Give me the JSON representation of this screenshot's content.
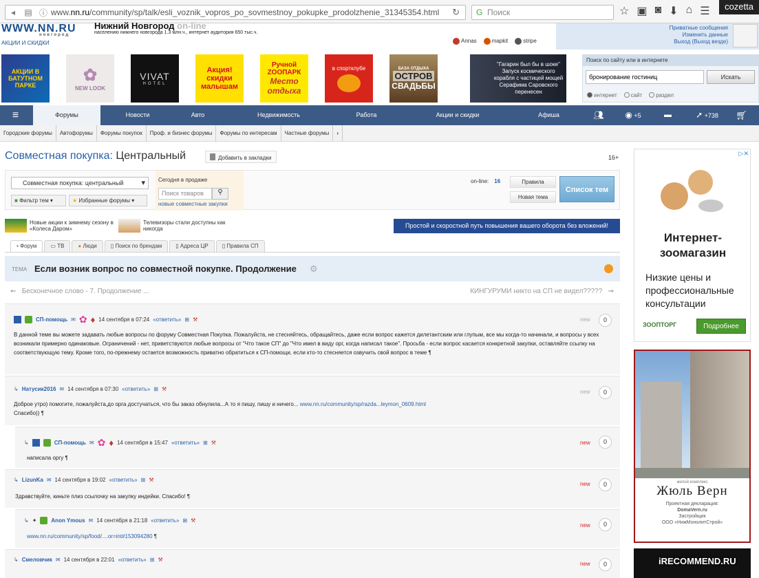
{
  "browser": {
    "url_prefix": "www.",
    "url_domain": "nn.ru",
    "url_path": "/community/sp/talk/esli_voznik_vopros_po_sovmestnoy_pokupke_prodolzhenie_31345354.html",
    "search_placeholder": "Поиск",
    "watermark_user": "cozetta"
  },
  "site": {
    "logo": "WWW.NN.RU",
    "logo_sub": "новгород",
    "city": "Нижний Новгород",
    "city_suffix": "on-line",
    "desc": "населению нижнего новгорода 1.3 млн.ч., интернет аудитория 650 тыс.ч.",
    "promo_link": "АКЦИИ И СКИДКИ",
    "partners": [
      "Annas",
      "mapkit",
      "stripe"
    ],
    "user_links": [
      "Приватные сообщения",
      "Изменить данные",
      "Выход (Выход везде)"
    ]
  },
  "banners": {
    "b1": "АКЦИИ В БАТУТНОМ ПАРКЕ",
    "b2": "NEW LOOK",
    "b3": "VIVAT",
    "b3_sub": "HOTEL",
    "b4": "Акция! скидки малышам",
    "b5_top": "Ручной ZOOПАРК",
    "b5_bottom": "Место отдыха",
    "b6": "в спортклубе",
    "b7_top": "БАЗА ОТДЫХА",
    "b7_mid": "ОСТРОВ",
    "b7_bottom": "СВАДЬБЫ",
    "b8": "\"Гагарин был бы в шоке\" Запуск космического корабля с частицей мощей Серафима Саровского перенесен"
  },
  "search": {
    "header": "Поиск по сайту или в интернете",
    "value": "бронирование гостиниц",
    "button": "Искать",
    "r1": "интернет",
    "r2": "сайт",
    "r3": "раздел"
  },
  "nav": {
    "forums": "Форумы",
    "news": "Новости",
    "auto": "Авто",
    "realty": "Недвижимость",
    "jobs": "Работа",
    "sales": "Акции и скидки",
    "afisha": "Афиша",
    "views": "+5",
    "rating": "+738"
  },
  "subnav": [
    "Городские форумы",
    "Автофорумы",
    "Форумы покупок",
    "Проф. и бизнес форумы",
    "Форумы по интересам",
    "Частные форумы"
  ],
  "page": {
    "title_prefix": "Совместная покупка:",
    "title_section": "Центральный",
    "bookmark": "Добавить в закладки",
    "age": "16+",
    "select": "Совместная покупка: центральный",
    "filter": "Фильтр тем",
    "favorites": "Избранные форумы",
    "sale_title": "Сегодня в продаже",
    "sale_placeholder": "Поиск товаров",
    "sale_link": "новые совместные закупки",
    "online_label": "on-line:",
    "online_count": "16",
    "rules": "Правила",
    "new_topic": "Новая тема",
    "list": "Список тем",
    "news1": "Новые акции к зимнему сезону в «Колеса Даром»",
    "news2": "Телевизоры стали доступны как никогда",
    "strip": "Простой и скоростной путь повышения вашего оборота без вложений!"
  },
  "tabs": [
    "Форум",
    "ТВ",
    "Люди",
    "Поиск по брендам",
    "Адреса ЦР",
    "Правила СП"
  ],
  "topic": {
    "label": "ТЕМА",
    "title": "Если возник вопрос по совместной покупке. Продолжение",
    "prev": "Бесконечное слово - 7. Продолжение ...",
    "next": "КИНГУРУМИ никто на СП не видел?????"
  },
  "posts": [
    {
      "user": "СП-помощь",
      "date": "14 сентября в 07:24",
      "reply": "«ответить»",
      "text": "В данной теме вы можете задавать любые вопросы по форуму Совместная Покупка. Пожалуйста, не стесняйтесь, обращайтесь, даже если вопрос кажется дилетантским или глупым, все мы когда-то начинали, и вопросы у всех возникали примерно одинаковые. Ограничений - нет, приветствуются любые вопросы от \"Что такое СП\" до \"Что имел в виду орг, когда написал такое\". Просьба - если вопрос касается конкретной закупки, оставляйте ссылку на соответствующую тему. Кроме того, по-прежнему остается возможность приватно обратиться к СП-помощи, если кто-то стесняется озвучить свой вопрос в теме ¶",
      "status": "new",
      "count": "0"
    },
    {
      "user": "Натусик2016",
      "date": "14 сентября в 07:30",
      "reply": "«ответить»",
      "text": "Доброе утро) помогите, пожалуйста,до орга достучаться, что бы заказ обнулила...А то я пишу, пишу и ничего...",
      "link": "www.nn.ru/community/sp/razda...leymon_0609.html",
      "text2": "Спасибо)) ¶",
      "status": "new",
      "count": "0"
    },
    {
      "user": "СП-помощь",
      "date": "14 сентября в 15:47",
      "reply": "«ответить»",
      "text": "написала оргу ¶",
      "status": "new",
      "count": "0"
    },
    {
      "user": "LizunKa",
      "date": "14 сентября в 19:02",
      "reply": "«ответить»",
      "text": "Здравствуйте, киньте плиз ссылочку на закупку индейки. Спасибо! ¶",
      "status": "new",
      "count": "0"
    },
    {
      "user": "Anon Ymous",
      "date": "14 сентября в 21:18",
      "reply": "«ответить»",
      "link": "www.nn.ru/community/sp/food/....or=int#153094280",
      "text": "¶",
      "status": "new",
      "count": "0"
    },
    {
      "user": "Смеловчик",
      "date": "14 сентября в 22:01",
      "reply": "«ответить»",
      "status": "new",
      "count": "0"
    }
  ],
  "ads": {
    "pet_title": "Интернет-зоомагазин",
    "pet_desc": "Низкие цены и профессиональные консультации",
    "pet_brand": "ЗООПТОРГ",
    "pet_button": "Подробнее",
    "bld_small": "жилой комплекс",
    "bld_name": "Жюль Верн",
    "bld_decl": "Проектная декларация:",
    "bld_site": "DomaVern.ru",
    "bld_dev": "Застройщик",
    "bld_org": "ООО «НижМонолитСтрой»",
    "watermark": "iRECOMMEND.RU"
  },
  "colors": {
    "nav_bg": "#3c5a86",
    "link": "#2a5fa8",
    "new_red": "#d42020",
    "topic_bg": "#e5edf7",
    "strip_bg": "#264b93"
  }
}
